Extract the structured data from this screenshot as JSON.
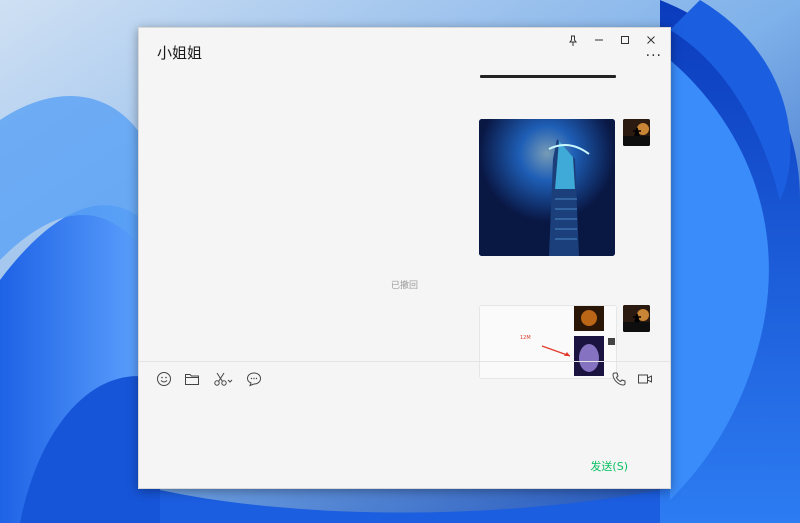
{
  "window": {
    "title": "小姐姐",
    "buttons": {
      "pin": "⊥",
      "minimize": "—",
      "maximize": "☐",
      "close": "✕"
    },
    "more_label": "···"
  },
  "chat": {
    "recalled_notice": "已撤回",
    "card_annotation": "12M"
  },
  "toolbar": {
    "left_icons": [
      "emoji-icon",
      "folder-icon",
      "scissors-icon",
      "chat-history-icon"
    ],
    "right_icons": [
      "phone-icon",
      "video-icon"
    ]
  },
  "composer": {
    "send_label": "发送(S)"
  },
  "colors": {
    "send": "#07c160",
    "window_bg": "#f5f5f5",
    "desktop": "#2a78e0"
  }
}
